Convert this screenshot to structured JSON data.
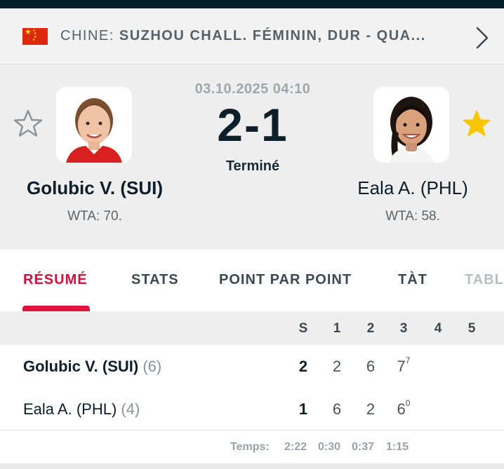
{
  "header": {
    "country": "CHINE:",
    "tournament": "SUZHOU CHALL. FÉMININ, DUR - QUA..."
  },
  "match": {
    "datetime": "03.10.2025 04:10",
    "score": "2-1",
    "status": "Terminé",
    "home": {
      "name": "Golubic V. (SUI)",
      "rank": "WTA: 70.",
      "favorite": false
    },
    "away": {
      "name": "Eala A. (PHL)",
      "rank": "WTA: 58.",
      "favorite": true
    }
  },
  "tabs": [
    "RÉSUMÉ",
    "STATS",
    "POINT PAR POINT",
    "TÀT",
    "TABL"
  ],
  "sets": {
    "headers": [
      "S",
      "1",
      "2",
      "3",
      "4",
      "5"
    ],
    "rows": [
      {
        "name": "Golubic V. (SUI)",
        "seed": "(6)",
        "total": "2",
        "s1": "2",
        "s2": "6",
        "s3": "7",
        "s3_tb": "7"
      },
      {
        "name": "Eala A. (PHL)",
        "seed": "(4)",
        "total": "1",
        "s1": "6",
        "s2": "2",
        "s3": "6",
        "s3_tb": "0"
      }
    ],
    "time_label": "Temps:",
    "times": [
      "2:22",
      "0:30",
      "0:37",
      "1:15"
    ]
  },
  "colors": {
    "accent": "#e2143f",
    "star_active": "#f7c600",
    "dark": "#001e28"
  }
}
